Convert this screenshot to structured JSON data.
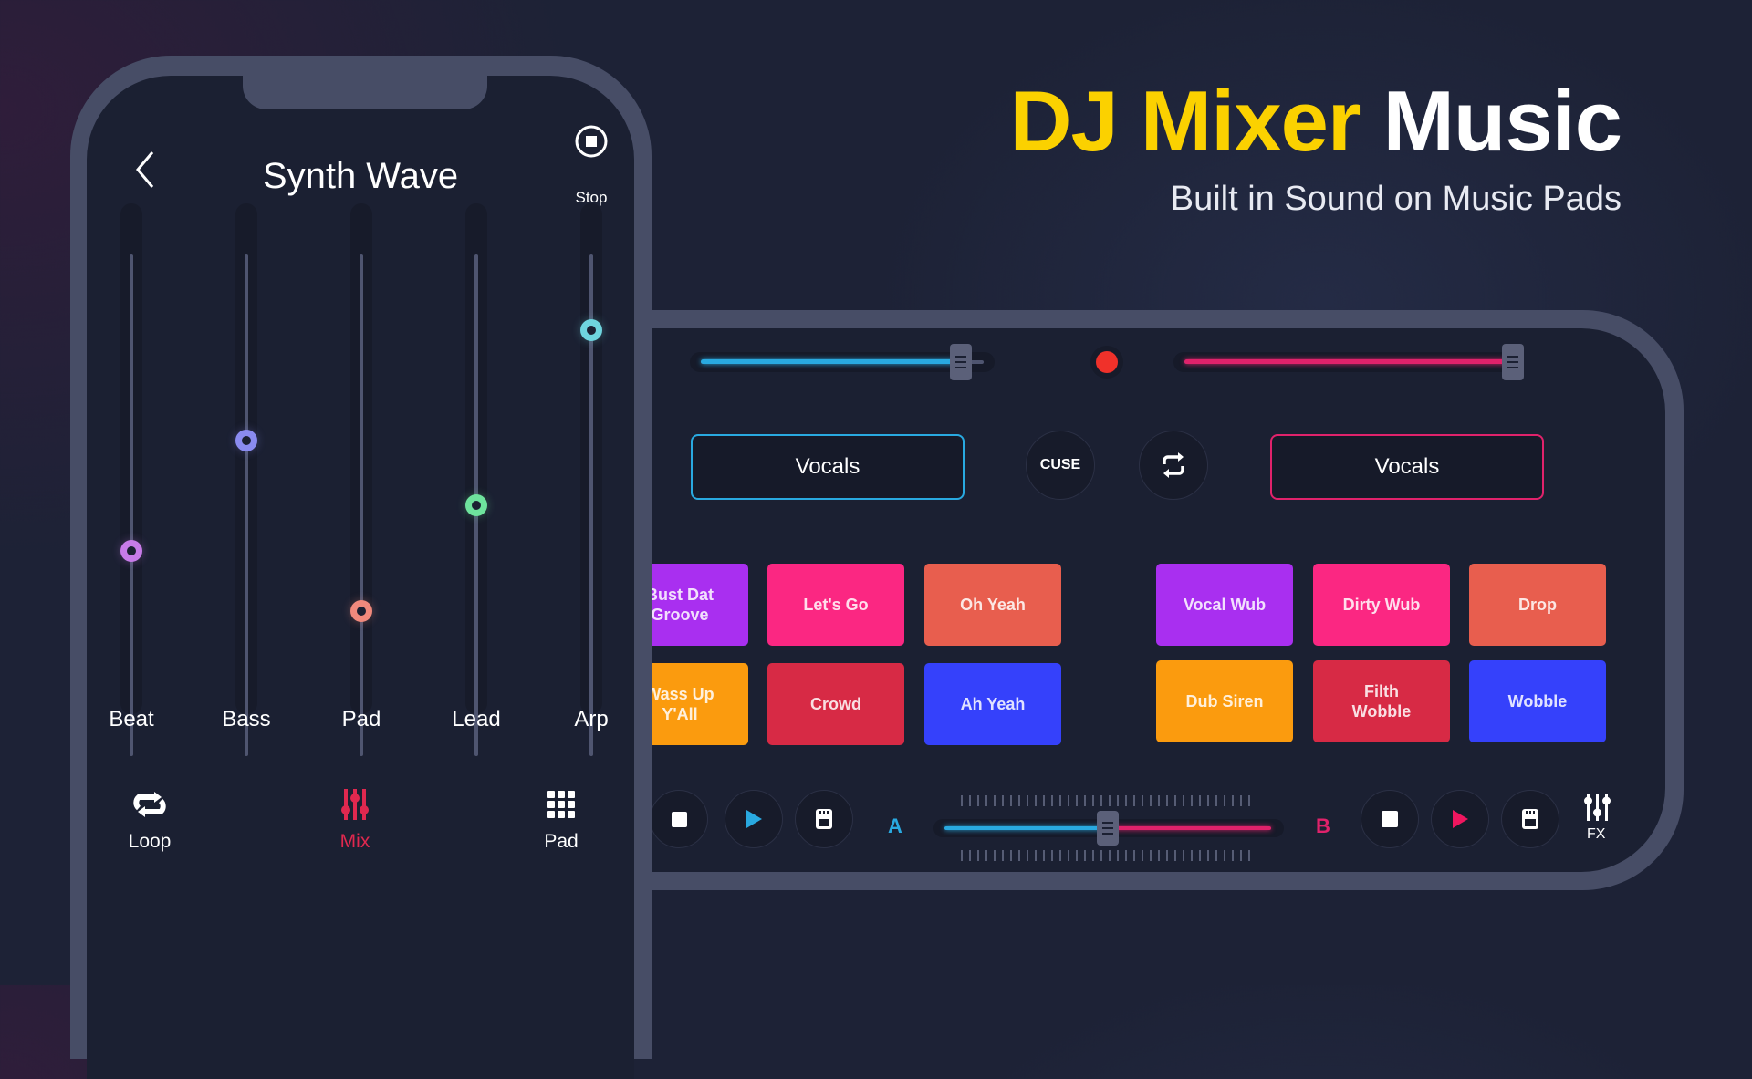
{
  "hero": {
    "title_highlight": "DJ Mixer",
    "title_rest": "Music",
    "subtitle": "Built in Sound on Music Pads",
    "highlight_color": "#fbd100"
  },
  "phone": {
    "title": "Synth Wave",
    "back_icon": "chevron-left-icon",
    "stop_label": "Stop",
    "stop_icon": "stop-circle-icon",
    "channels": [
      {
        "label": "Beat",
        "level": 0.41,
        "color": "#c77be8"
      },
      {
        "label": "Bass",
        "level": 0.63,
        "color": "#8a8bf0"
      },
      {
        "label": "Pad",
        "level": 0.29,
        "color": "#f0897c"
      },
      {
        "label": "Lead",
        "level": 0.5,
        "color": "#6ee39d"
      },
      {
        "label": "Arp",
        "level": 0.85,
        "color": "#6fd4de"
      }
    ],
    "nav": [
      {
        "label": "Loop",
        "icon": "loop-icon",
        "active": false
      },
      {
        "label": "Mix",
        "icon": "mixer-icon",
        "active": true
      },
      {
        "label": "Pad",
        "icon": "grid-icon",
        "active": false
      }
    ],
    "active_color": "#e0284f"
  },
  "mixer": {
    "deck_a": {
      "volume": 0.92,
      "color": "#29a9e0",
      "track": "Vocals",
      "letter": "A",
      "pads": [
        {
          "label": "Bust Dat Groove",
          "color": "#a92ff0"
        },
        {
          "label": "Let's Go",
          "color": "#fb2782"
        },
        {
          "label": "Oh Yeah",
          "color": "#e85e4e"
        },
        {
          "label": "Wass Up Y'All",
          "color": "#fb9b0e"
        },
        {
          "label": "Crowd",
          "color": "#d72a45"
        },
        {
          "label": "Ah Yeah",
          "color": "#3541fb"
        }
      ]
    },
    "deck_b": {
      "volume": 1.0,
      "color": "#e0226b",
      "track": "Vocals",
      "letter": "B",
      "pads": [
        {
          "label": "Vocal Wub",
          "color": "#a92ff0"
        },
        {
          "label": "Dirty Wub",
          "color": "#fb2782"
        },
        {
          "label": "Drop",
          "color": "#e85e4e"
        },
        {
          "label": "Dub Siren",
          "color": "#fb9b0e"
        },
        {
          "label": "Filth Wobble",
          "color": "#d72a45"
        },
        {
          "label": "Wobble",
          "color": "#3541fb"
        }
      ]
    },
    "record_color": "#f0312a",
    "cuse_label": "CUSE",
    "sync_icon": "repeat-icon",
    "crossfader": 0.5,
    "fx_label": "FX"
  }
}
